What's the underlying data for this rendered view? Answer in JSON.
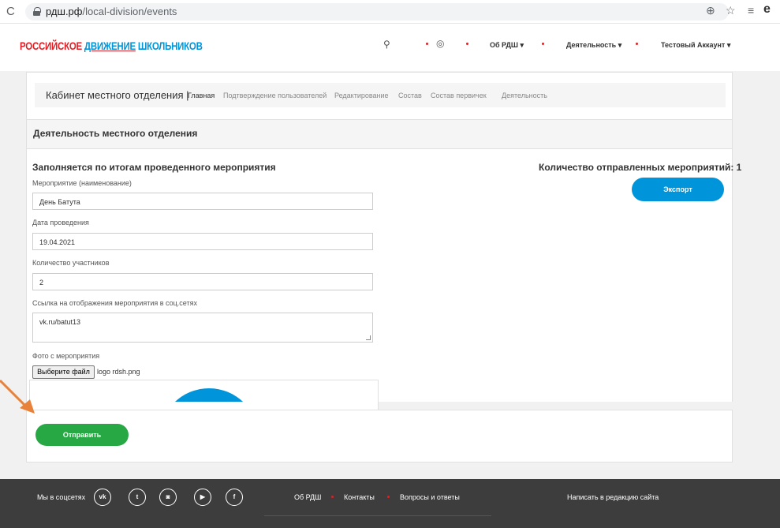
{
  "browser": {
    "url_domain": "рдш.рф",
    "url_path": "/local-division/events"
  },
  "header": {
    "logo_part1": "РОССИЙСКОЕ",
    "logo_part2": "ДВИЖЕНИЕ",
    "logo_part3": "ШКОЛЬНИКОВ",
    "nav": {
      "about": "Об РДШ ▾",
      "activity": "Деятельность ▾",
      "account": "Тестовый Аккаунт ▾"
    }
  },
  "cabinet": {
    "title": "Кабинет местного отделения |",
    "links": [
      "Главная",
      "Подтверждение пользователей",
      "Редактирование",
      "Состав",
      "Состав первичек",
      "Деятельность"
    ]
  },
  "section": {
    "title": "Деятельность местного отделения"
  },
  "form": {
    "title": "Заполняется по итогам проведенного мероприятия",
    "count_label": "Количество отправленных мероприятий: 1",
    "export_label": "Экспорт",
    "fields": [
      {
        "label": "Мероприятие (наименование)",
        "value": "День Батута"
      },
      {
        "label": "Дата проведения",
        "value": "19.04.2021"
      },
      {
        "label": "Количество участников",
        "value": "2"
      },
      {
        "label": "Ссылка на отображения мероприятия в соц.сетях",
        "value": "vk.ru/batut13"
      }
    ],
    "photo_label": "Фото с мероприятия",
    "file_button": "Выберите файл",
    "file_name": "logo rdsh.png",
    "submit_label": "Отправить"
  },
  "footer": {
    "social_label": "Мы в соцсетях",
    "social_icons": [
      "vk-icon",
      "twitter-icon",
      "instagram-icon",
      "youtube-icon",
      "facebook-icon"
    ],
    "links": [
      "Об РДШ",
      "Контакты",
      "Вопросы и ответы"
    ],
    "write_label": "Написать в редакцию сайта"
  },
  "colors": {
    "brand_red": "#e31e24",
    "brand_blue": "#0095da",
    "submit_green": "#28a745",
    "annotation_arrow": "#e8823a"
  }
}
